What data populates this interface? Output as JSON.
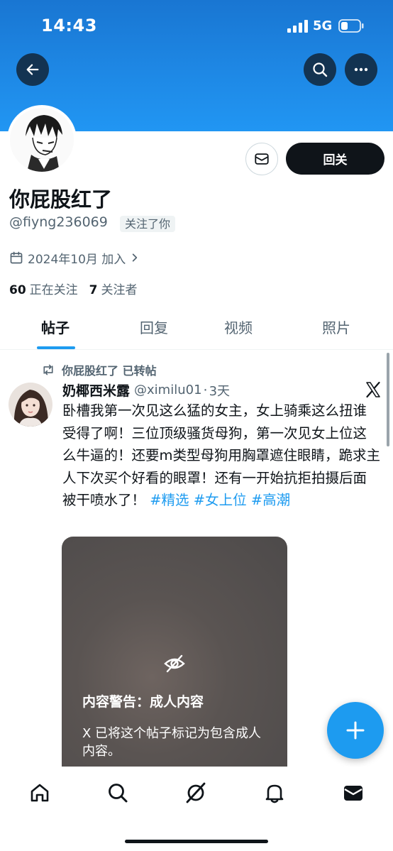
{
  "status_bar": {
    "time": "14:43",
    "network": "5G"
  },
  "header": {
    "back_icon": "arrow-left-icon",
    "search_icon": "search-icon",
    "more_icon": "more-horizontal-icon"
  },
  "profile": {
    "display_name": "你屁股红了",
    "handle": "@fiyng236069",
    "follows_you": "关注了你",
    "joined": "2024年10月 加入",
    "following_count": "60",
    "following_label": "正在关注",
    "followers_count": "7",
    "followers_label": "关注者",
    "follow_button": "回关"
  },
  "tabs": [
    {
      "label": "帖子",
      "active": true
    },
    {
      "label": "回复",
      "active": false
    },
    {
      "label": "视频",
      "active": false
    },
    {
      "label": "照片",
      "active": false
    }
  ],
  "post": {
    "repost_label": "你屁股红了 已转帖",
    "author": "奶椰西米露",
    "author_handle": "@ximilu01",
    "separator": "·",
    "age": "3天",
    "text": "卧槽我第一次见这么猛的女主，女上骑乘这么扭谁受得了啊！三位顶级骚货母狗，第一次见女上位这么牛逼的！还要m类型母狗用胸罩遮住眼睛，跪求主人下次买个好看的眼罩！还有一开始抗拒拍摄后面被干喷水了！",
    "hashtags": [
      "#精选",
      "#女上位",
      "#高潮"
    ],
    "media_warning_title": "内容警告：成人内容",
    "media_warning_body": "X 已将这个帖子标记为包含成人内容。"
  },
  "bottom_nav": [
    "home-icon",
    "search-icon",
    "grok-icon",
    "notifications-icon",
    "messages-icon"
  ],
  "colors": {
    "accent": "#1d9bf0",
    "banner": "#1e88e5",
    "text": "#0f1419",
    "muted": "#536471"
  }
}
